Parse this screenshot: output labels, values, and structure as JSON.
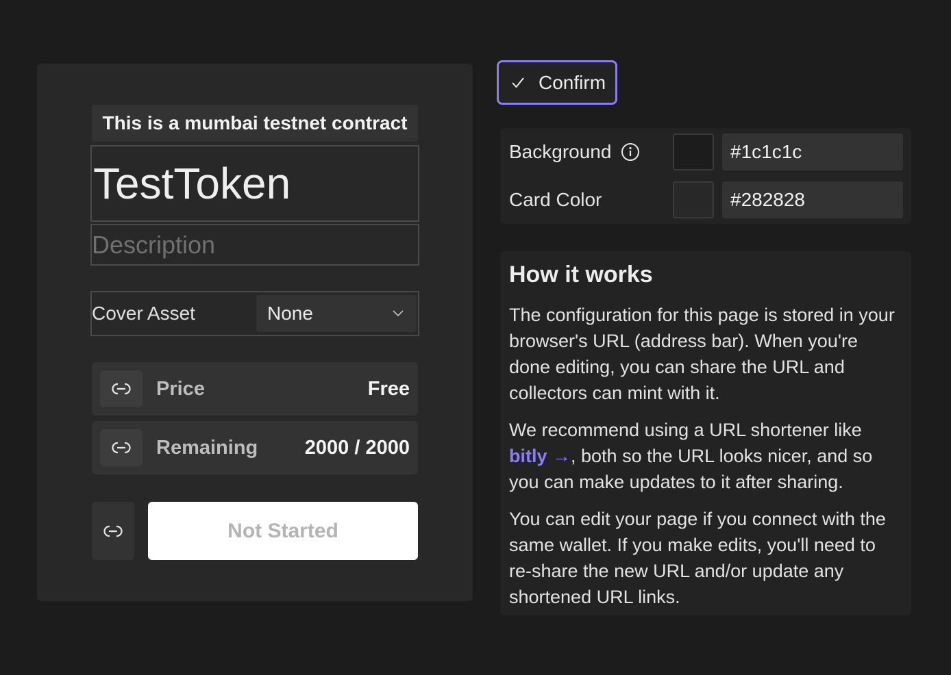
{
  "card": {
    "testnet_banner": "This is a mumbai testnet contract",
    "title": "TestToken",
    "description_placeholder": "Description",
    "cover_asset": {
      "label": "Cover Asset",
      "selected": "None"
    },
    "price": {
      "label": "Price",
      "value": "Free"
    },
    "remaining": {
      "label": "Remaining",
      "value": "2000 / 2000"
    },
    "status_button": "Not Started"
  },
  "confirm": {
    "label": "Confirm",
    "accent": "#8b7cf8"
  },
  "colors": {
    "background": {
      "label": "Background",
      "value": "#1c1c1c"
    },
    "card_color": {
      "label": "Card Color",
      "value": "#282828"
    }
  },
  "how_it_works": {
    "title": "How it works",
    "paragraph1": "The configuration for this page is stored in your browser's URL (address bar). When you're done editing, you can share the URL and collectors can mint with it.",
    "paragraph2_before": "We recommend using a URL shortener like ",
    "paragraph2_link": "bitly →",
    "paragraph2_after": ", both so the URL looks nicer, and so you can make updates to it after sharing.",
    "paragraph3": "You can edit your page if you connect with the same wallet. If you make edits, you'll need to re-share the new URL and/or update any shortened URL links."
  },
  "icons": [
    "link-icon",
    "chevron-down-icon",
    "check-icon",
    "info-icon"
  ]
}
